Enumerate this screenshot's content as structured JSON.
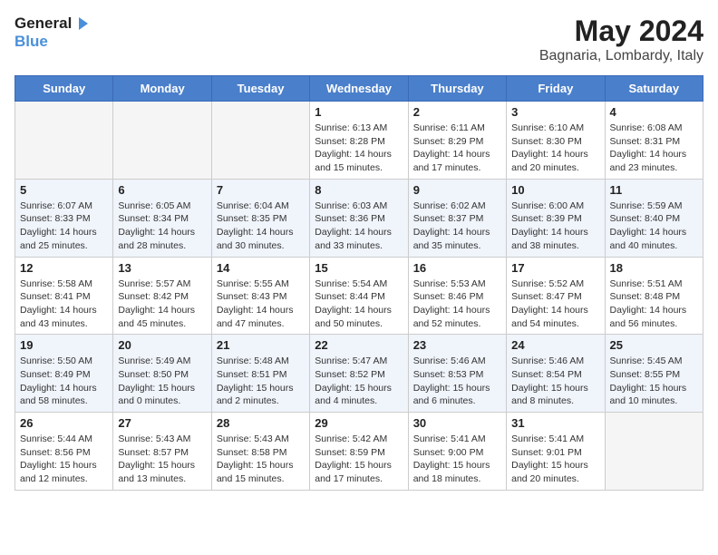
{
  "logo": {
    "line1": "General",
    "line2": "Blue"
  },
  "header": {
    "month": "May 2024",
    "location": "Bagnaria, Lombardy, Italy"
  },
  "days_of_week": [
    "Sunday",
    "Monday",
    "Tuesday",
    "Wednesday",
    "Thursday",
    "Friday",
    "Saturday"
  ],
  "weeks": [
    [
      {
        "day": "",
        "sunrise": "",
        "sunset": "",
        "daylight": ""
      },
      {
        "day": "",
        "sunrise": "",
        "sunset": "",
        "daylight": ""
      },
      {
        "day": "",
        "sunrise": "",
        "sunset": "",
        "daylight": ""
      },
      {
        "day": "1",
        "sunrise": "Sunrise: 6:13 AM",
        "sunset": "Sunset: 8:28 PM",
        "daylight": "Daylight: 14 hours and 15 minutes."
      },
      {
        "day": "2",
        "sunrise": "Sunrise: 6:11 AM",
        "sunset": "Sunset: 8:29 PM",
        "daylight": "Daylight: 14 hours and 17 minutes."
      },
      {
        "day": "3",
        "sunrise": "Sunrise: 6:10 AM",
        "sunset": "Sunset: 8:30 PM",
        "daylight": "Daylight: 14 hours and 20 minutes."
      },
      {
        "day": "4",
        "sunrise": "Sunrise: 6:08 AM",
        "sunset": "Sunset: 8:31 PM",
        "daylight": "Daylight: 14 hours and 23 minutes."
      }
    ],
    [
      {
        "day": "5",
        "sunrise": "Sunrise: 6:07 AM",
        "sunset": "Sunset: 8:33 PM",
        "daylight": "Daylight: 14 hours and 25 minutes."
      },
      {
        "day": "6",
        "sunrise": "Sunrise: 6:05 AM",
        "sunset": "Sunset: 8:34 PM",
        "daylight": "Daylight: 14 hours and 28 minutes."
      },
      {
        "day": "7",
        "sunrise": "Sunrise: 6:04 AM",
        "sunset": "Sunset: 8:35 PM",
        "daylight": "Daylight: 14 hours and 30 minutes."
      },
      {
        "day": "8",
        "sunrise": "Sunrise: 6:03 AM",
        "sunset": "Sunset: 8:36 PM",
        "daylight": "Daylight: 14 hours and 33 minutes."
      },
      {
        "day": "9",
        "sunrise": "Sunrise: 6:02 AM",
        "sunset": "Sunset: 8:37 PM",
        "daylight": "Daylight: 14 hours and 35 minutes."
      },
      {
        "day": "10",
        "sunrise": "Sunrise: 6:00 AM",
        "sunset": "Sunset: 8:39 PM",
        "daylight": "Daylight: 14 hours and 38 minutes."
      },
      {
        "day": "11",
        "sunrise": "Sunrise: 5:59 AM",
        "sunset": "Sunset: 8:40 PM",
        "daylight": "Daylight: 14 hours and 40 minutes."
      }
    ],
    [
      {
        "day": "12",
        "sunrise": "Sunrise: 5:58 AM",
        "sunset": "Sunset: 8:41 PM",
        "daylight": "Daylight: 14 hours and 43 minutes."
      },
      {
        "day": "13",
        "sunrise": "Sunrise: 5:57 AM",
        "sunset": "Sunset: 8:42 PM",
        "daylight": "Daylight: 14 hours and 45 minutes."
      },
      {
        "day": "14",
        "sunrise": "Sunrise: 5:55 AM",
        "sunset": "Sunset: 8:43 PM",
        "daylight": "Daylight: 14 hours and 47 minutes."
      },
      {
        "day": "15",
        "sunrise": "Sunrise: 5:54 AM",
        "sunset": "Sunset: 8:44 PM",
        "daylight": "Daylight: 14 hours and 50 minutes."
      },
      {
        "day": "16",
        "sunrise": "Sunrise: 5:53 AM",
        "sunset": "Sunset: 8:46 PM",
        "daylight": "Daylight: 14 hours and 52 minutes."
      },
      {
        "day": "17",
        "sunrise": "Sunrise: 5:52 AM",
        "sunset": "Sunset: 8:47 PM",
        "daylight": "Daylight: 14 hours and 54 minutes."
      },
      {
        "day": "18",
        "sunrise": "Sunrise: 5:51 AM",
        "sunset": "Sunset: 8:48 PM",
        "daylight": "Daylight: 14 hours and 56 minutes."
      }
    ],
    [
      {
        "day": "19",
        "sunrise": "Sunrise: 5:50 AM",
        "sunset": "Sunset: 8:49 PM",
        "daylight": "Daylight: 14 hours and 58 minutes."
      },
      {
        "day": "20",
        "sunrise": "Sunrise: 5:49 AM",
        "sunset": "Sunset: 8:50 PM",
        "daylight": "Daylight: 15 hours and 0 minutes."
      },
      {
        "day": "21",
        "sunrise": "Sunrise: 5:48 AM",
        "sunset": "Sunset: 8:51 PM",
        "daylight": "Daylight: 15 hours and 2 minutes."
      },
      {
        "day": "22",
        "sunrise": "Sunrise: 5:47 AM",
        "sunset": "Sunset: 8:52 PM",
        "daylight": "Daylight: 15 hours and 4 minutes."
      },
      {
        "day": "23",
        "sunrise": "Sunrise: 5:46 AM",
        "sunset": "Sunset: 8:53 PM",
        "daylight": "Daylight: 15 hours and 6 minutes."
      },
      {
        "day": "24",
        "sunrise": "Sunrise: 5:46 AM",
        "sunset": "Sunset: 8:54 PM",
        "daylight": "Daylight: 15 hours and 8 minutes."
      },
      {
        "day": "25",
        "sunrise": "Sunrise: 5:45 AM",
        "sunset": "Sunset: 8:55 PM",
        "daylight": "Daylight: 15 hours and 10 minutes."
      }
    ],
    [
      {
        "day": "26",
        "sunrise": "Sunrise: 5:44 AM",
        "sunset": "Sunset: 8:56 PM",
        "daylight": "Daylight: 15 hours and 12 minutes."
      },
      {
        "day": "27",
        "sunrise": "Sunrise: 5:43 AM",
        "sunset": "Sunset: 8:57 PM",
        "daylight": "Daylight: 15 hours and 13 minutes."
      },
      {
        "day": "28",
        "sunrise": "Sunrise: 5:43 AM",
        "sunset": "Sunset: 8:58 PM",
        "daylight": "Daylight: 15 hours and 15 minutes."
      },
      {
        "day": "29",
        "sunrise": "Sunrise: 5:42 AM",
        "sunset": "Sunset: 8:59 PM",
        "daylight": "Daylight: 15 hours and 17 minutes."
      },
      {
        "day": "30",
        "sunrise": "Sunrise: 5:41 AM",
        "sunset": "Sunset: 9:00 PM",
        "daylight": "Daylight: 15 hours and 18 minutes."
      },
      {
        "day": "31",
        "sunrise": "Sunrise: 5:41 AM",
        "sunset": "Sunset: 9:01 PM",
        "daylight": "Daylight: 15 hours and 20 minutes."
      },
      {
        "day": "",
        "sunrise": "",
        "sunset": "",
        "daylight": ""
      }
    ]
  ]
}
